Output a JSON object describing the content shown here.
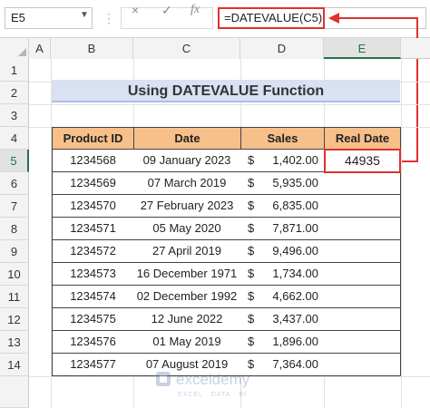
{
  "formula_bar": {
    "name_box": "E5",
    "cancel_icon": "×",
    "enter_icon": "✓",
    "fx_label": "fx",
    "formula": "=DATEVALUE(C5)"
  },
  "columns": [
    "A",
    "B",
    "C",
    "D",
    "E"
  ],
  "rows": [
    "1",
    "2",
    "3",
    "4",
    "5",
    "6",
    "7",
    "8",
    "9",
    "10",
    "11",
    "12",
    "13",
    "14"
  ],
  "selected_cell": {
    "column": "E",
    "row": "5"
  },
  "title": "Using DATEVALUE Function",
  "table": {
    "headers": [
      "Product ID",
      "Date",
      "Sales",
      "Real Date"
    ],
    "currency_symbol": "$",
    "rows": [
      {
        "id": "1234568",
        "date": "09 January 2023",
        "sales": "1,402.00",
        "real_date": "44935"
      },
      {
        "id": "1234569",
        "date": "07 March 2019",
        "sales": "5,935.00",
        "real_date": ""
      },
      {
        "id": "1234570",
        "date": "27 February 2023",
        "sales": "6,835.00",
        "real_date": ""
      },
      {
        "id": "1234571",
        "date": "05 May 2020",
        "sales": "7,871.00",
        "real_date": ""
      },
      {
        "id": "1234572",
        "date": "27 April 2019",
        "sales": "9,496.00",
        "real_date": ""
      },
      {
        "id": "1234573",
        "date": "16 December 1971",
        "sales": "1,734.00",
        "real_date": ""
      },
      {
        "id": "1234574",
        "date": "02 December 1992",
        "sales": "4,662.00",
        "real_date": ""
      },
      {
        "id": "1234575",
        "date": "12 June 2022",
        "sales": "3,437.00",
        "real_date": ""
      },
      {
        "id": "1234576",
        "date": "01 May 2019",
        "sales": "1,896.00",
        "real_date": ""
      },
      {
        "id": "1234577",
        "date": "07 August 2019",
        "sales": "7,364.00",
        "real_date": ""
      }
    ]
  },
  "watermark": {
    "name": "exceldemy",
    "tagline": "EXCEL · DATA · BI"
  },
  "colors": {
    "header_fill": "#f7c08a",
    "title_fill": "#d9e1f2",
    "highlight": "#e03030",
    "excel_green": "#217346"
  }
}
